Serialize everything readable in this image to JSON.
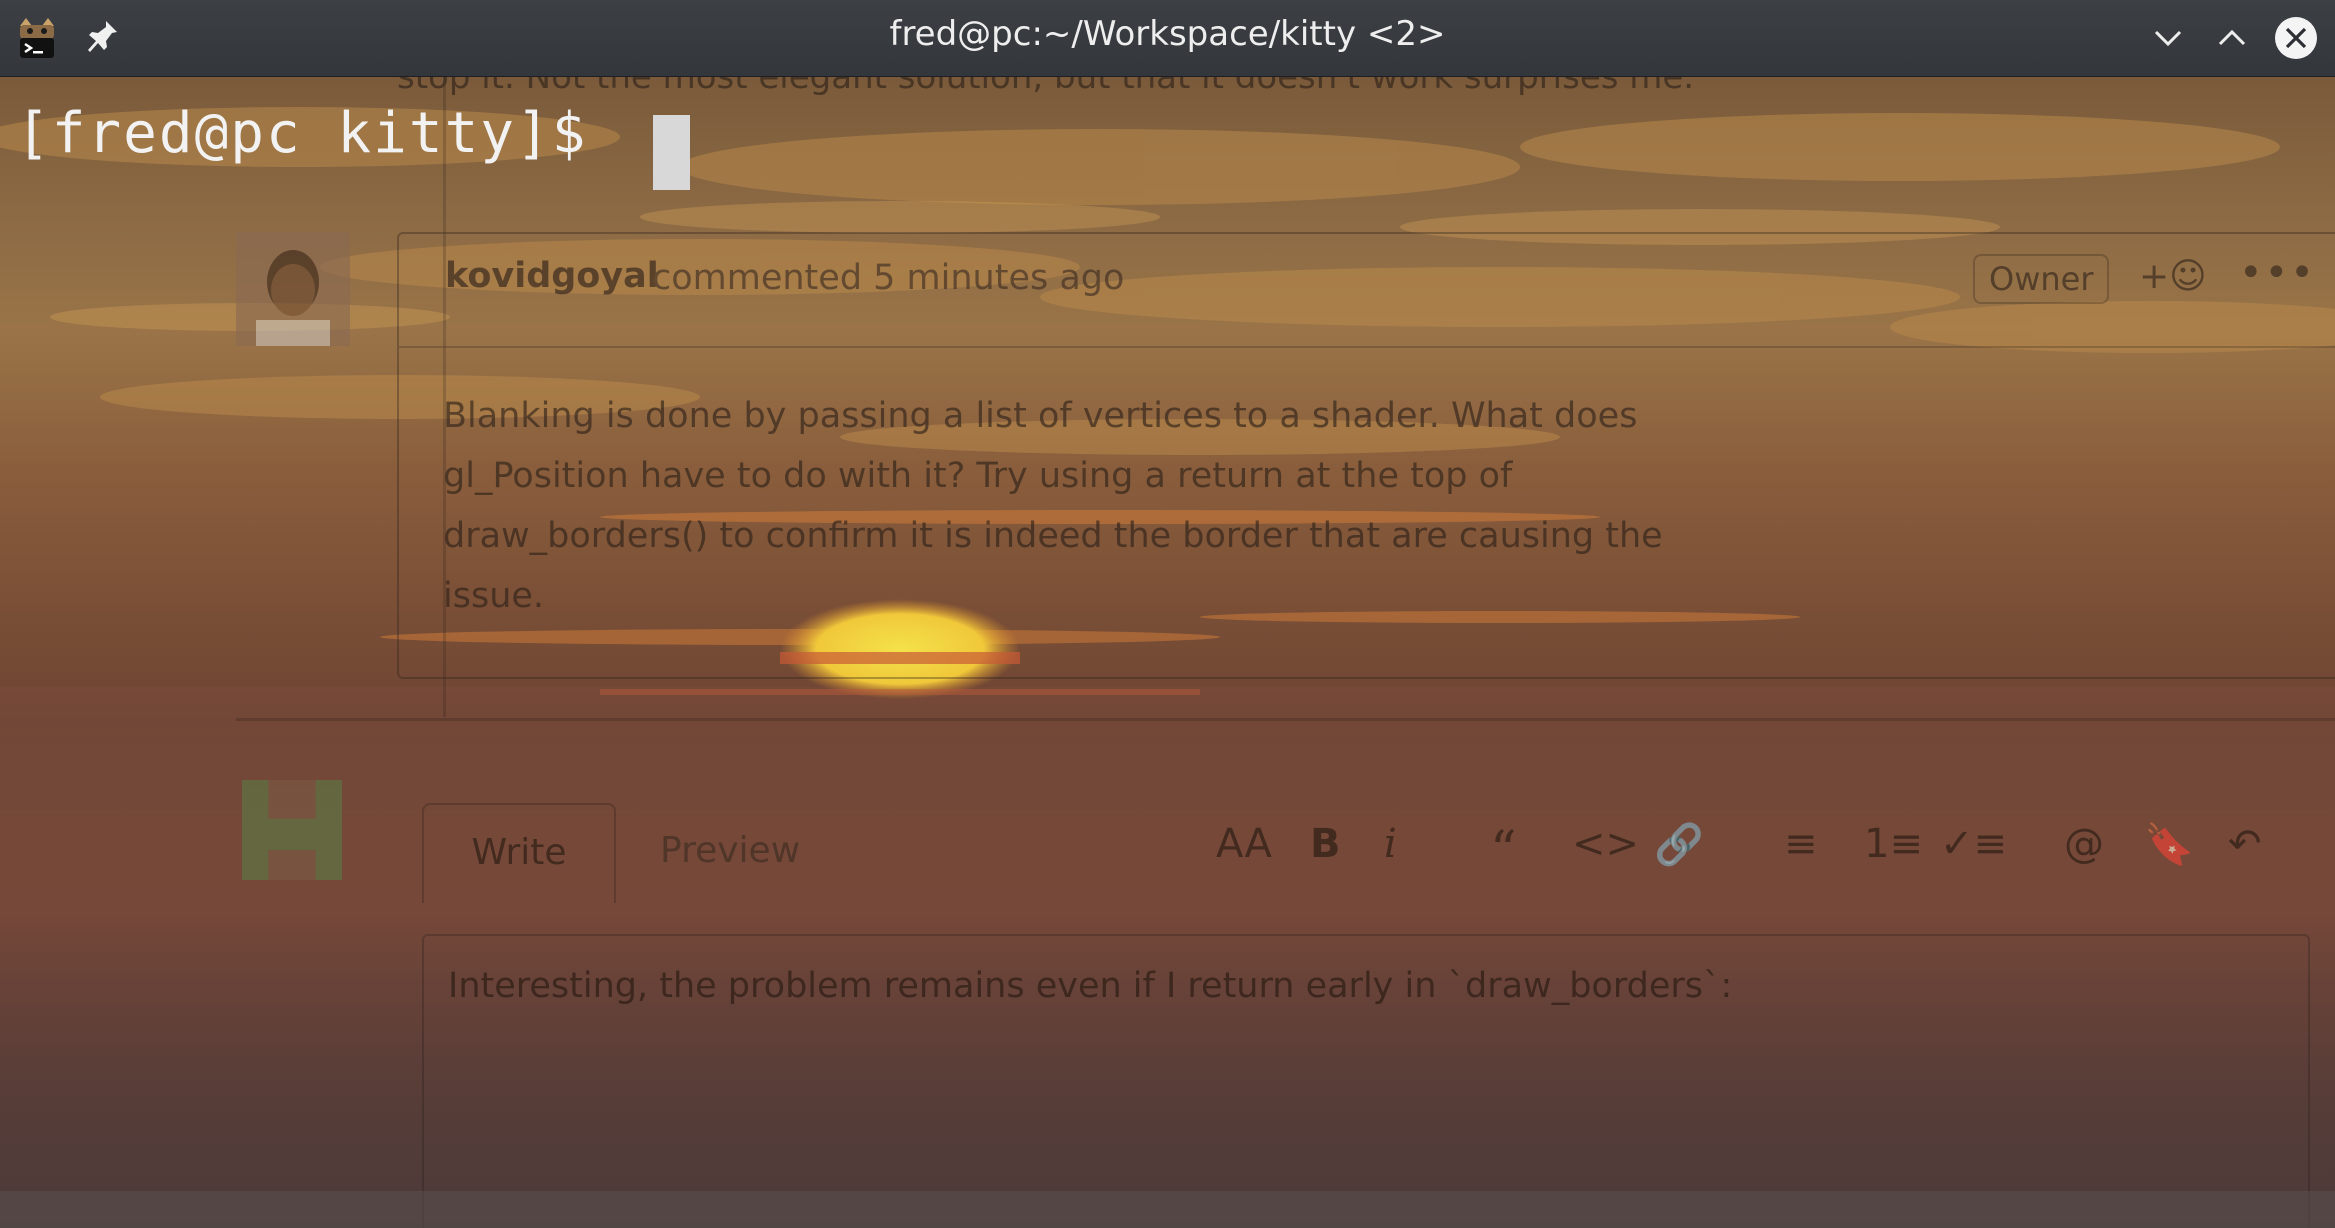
{
  "window": {
    "title": "fred@pc:~/Workspace/kitty <2>"
  },
  "terminal": {
    "prompt": "[fred@pc kitty]$ "
  },
  "background_page": {
    "top_fragment": "stop it. Not the most elegant solution, but that it doesn't work surprises me.",
    "comment": {
      "author": "kovidgoyal",
      "meta": "commented 5 minutes ago",
      "role": "Owner",
      "reaction": "+☺",
      "more": "•••",
      "body": "Blanking is done by passing a list of vertices to a shader. What does gl_Position have to do with it? Try using a return at the top of draw_borders() to confirm it is indeed the border that are causing the issue."
    },
    "editor": {
      "tab_write": "Write",
      "tab_preview": "Preview",
      "tools": [
        "AA",
        "B",
        "i",
        "“",
        "<>",
        "🔗",
        "≡",
        "1≡",
        "✓≡",
        "@",
        "🔖",
        "↶"
      ],
      "text": "Interesting, the problem remains even if I return early in `draw_borders`:"
    }
  },
  "colors": {
    "titlebar": "#363a3e",
    "prompt_text": "#f2f2f2",
    "cursor": "#d8d8d8"
  }
}
